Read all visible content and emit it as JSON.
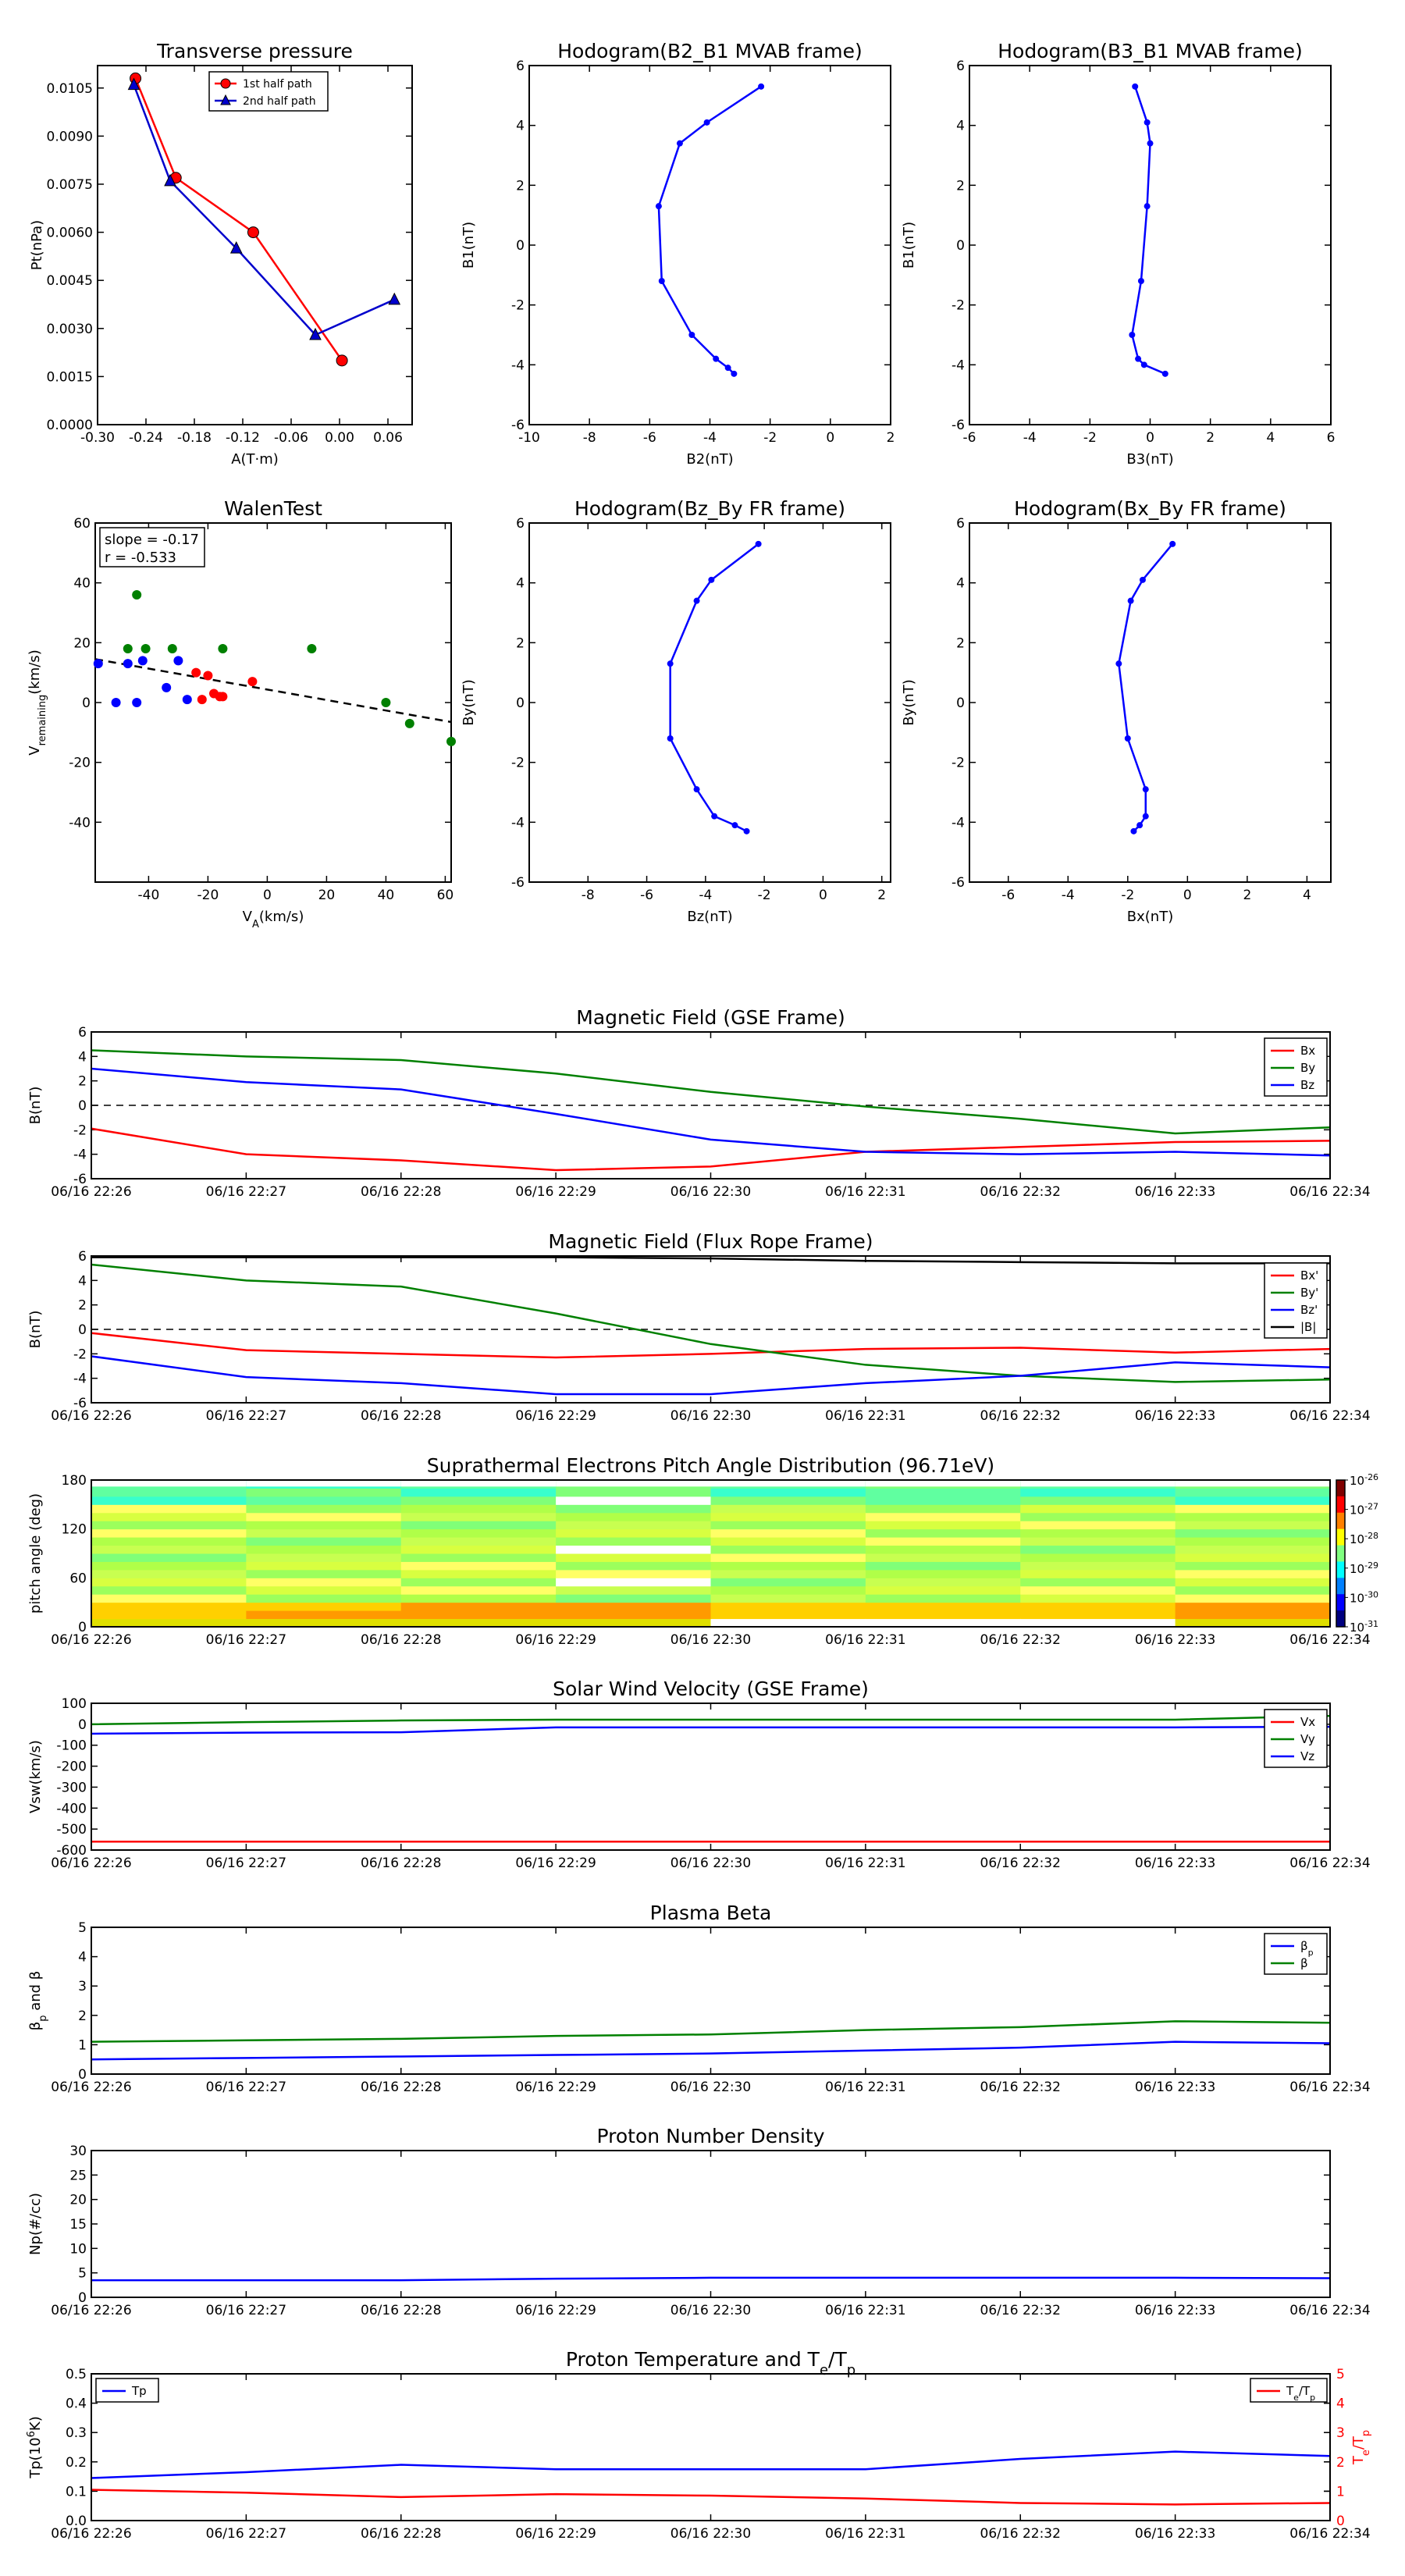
{
  "colors": {
    "red": "#ff0000",
    "green": "#008000",
    "blue": "#0000ff",
    "black": "#000000"
  },
  "chart_data": [
    {
      "id": "pt",
      "type": "scatter",
      "title": "Transverse pressure",
      "xlabel": "A(T·m)",
      "ylabel": "Pt(nPa)",
      "xlim": [
        -0.3,
        0.09
      ],
      "ylim": [
        0.0,
        0.0112
      ],
      "xticks": [
        "-0.30",
        "-0.24",
        "-0.18",
        "-0.12",
        "-0.06",
        "0.00",
        "0.06"
      ],
      "xtick_values": [
        -0.3,
        -0.24,
        -0.18,
        -0.12,
        -0.06,
        0.0,
        0.06
      ],
      "yticks": [
        "0.0000",
        "0.0015",
        "0.0030",
        "0.0045",
        "0.0060",
        "0.0075",
        "0.0090",
        "0.0105"
      ],
      "ytick_values": [
        0,
        0.0015,
        0.003,
        0.0045,
        0.006,
        0.0075,
        0.009,
        0.0105
      ],
      "legend": [
        {
          "label": "1st half path",
          "color": "#ff0000",
          "marker": "circle"
        },
        {
          "label": "2nd half path",
          "color": "#0000cc",
          "marker": "triangle"
        }
      ],
      "series": [
        {
          "name": "1st half path",
          "color": "#ff0000",
          "marker": "circle",
          "x": [
            -0.253,
            -0.203,
            -0.107,
            0.003
          ],
          "y": [
            0.0108,
            0.0077,
            0.006,
            0.002
          ]
        },
        {
          "name": "2nd half path",
          "color": "#0000cc",
          "marker": "triangle",
          "x": [
            -0.255,
            -0.21,
            -0.128,
            -0.03,
            0.068
          ],
          "y": [
            0.0106,
            0.0076,
            0.0055,
            0.0028,
            0.0039
          ]
        }
      ]
    },
    {
      "id": "h1",
      "type": "line",
      "title": "Hodogram(B2_B1 MVAB frame)",
      "xlabel": "B2(nT)",
      "ylabel": "B1(nT)",
      "xlim": [
        -10,
        2
      ],
      "ylim": [
        -6,
        6
      ],
      "xticks": [
        "-10",
        "-8",
        "-6",
        "-4",
        "-2",
        "0",
        "2"
      ],
      "xtick_values": [
        -10,
        -8,
        -6,
        -4,
        -2,
        0,
        2
      ],
      "yticks": [
        "-6",
        "-4",
        "-2",
        "0",
        "2",
        "4",
        "6"
      ],
      "ytick_values": [
        -6,
        -4,
        -2,
        0,
        2,
        4,
        6
      ],
      "series": [
        {
          "color": "#0000ff",
          "x": [
            -2.3,
            -4.1,
            -5.0,
            -5.7,
            -5.6,
            -4.6,
            -3.8,
            -3.4,
            -3.2
          ],
          "y": [
            5.3,
            4.1,
            3.4,
            1.3,
            -1.2,
            -3.0,
            -3.8,
            -4.1,
            -4.3
          ]
        }
      ]
    },
    {
      "id": "h2",
      "type": "line",
      "title": "Hodogram(B3_B1 MVAB frame)",
      "xlabel": "B3(nT)",
      "ylabel": "B1(nT)",
      "xlim": [
        -6,
        6
      ],
      "ylim": [
        -6,
        6
      ],
      "xticks": [
        "-6",
        "-4",
        "-2",
        "0",
        "2",
        "4",
        "6"
      ],
      "xtick_values": [
        -6,
        -4,
        -2,
        0,
        2,
        4,
        6
      ],
      "yticks": [
        "-6",
        "-4",
        "-2",
        "0",
        "2",
        "4",
        "6"
      ],
      "ytick_values": [
        -6,
        -4,
        -2,
        0,
        2,
        4,
        6
      ],
      "series": [
        {
          "color": "#0000ff",
          "x": [
            -0.5,
            -0.1,
            0.0,
            -0.1,
            -0.3,
            -0.6,
            -0.4,
            -0.2,
            0.5
          ],
          "y": [
            5.3,
            4.1,
            3.4,
            1.3,
            -1.2,
            -3.0,
            -3.8,
            -4.0,
            -4.3
          ]
        }
      ]
    },
    {
      "id": "walen",
      "type": "scatter",
      "title": "WalenTest",
      "xlabel": "V<sub>A</sub>(km/s)",
      "ylabel": "V<sub>remaining</sub>(km/s)",
      "xlim": [
        -58,
        62
      ],
      "ylim": [
        -60,
        60
      ],
      "xticks": [
        "-40",
        "-20",
        "0",
        "20",
        "40",
        "60"
      ],
      "xtick_values": [
        -40,
        -20,
        0,
        20,
        40,
        60
      ],
      "yticks": [
        "-40",
        "-20",
        "0",
        "20",
        "40",
        "60"
      ],
      "ytick_values": [
        -40,
        -20,
        0,
        20,
        40,
        60
      ],
      "annotation": [
        "slope = -0.17",
        "r = -0.533"
      ],
      "fit_line": {
        "x": [
          -58,
          62
        ],
        "y": [
          14.5,
          -6.5
        ]
      },
      "series": [
        {
          "color": "#0000ff",
          "x": [
            -57,
            -51,
            -47,
            -44,
            -42,
            -34,
            -30,
            -27
          ],
          "y": [
            13,
            0,
            13,
            0,
            14,
            5,
            14,
            1
          ]
        },
        {
          "color": "#ff0000",
          "x": [
            -24,
            -22,
            -20,
            -18,
            -16,
            -15,
            -5
          ],
          "y": [
            10,
            1,
            9,
            3,
            2,
            2,
            7
          ]
        },
        {
          "color": "#008000",
          "x": [
            -47,
            -44,
            -41,
            -32,
            -15,
            15,
            40,
            48,
            62
          ],
          "y": [
            18,
            36,
            18,
            18,
            18,
            18,
            0,
            -7,
            -13
          ]
        }
      ]
    },
    {
      "id": "h3",
      "type": "line",
      "title": "Hodogram(Bz_By FR frame)",
      "xlabel": "Bz(nT)",
      "ylabel": "By(nT)",
      "xlim": [
        -10,
        2.3
      ],
      "ylim": [
        -6,
        6
      ],
      "xticks": [
        "-8",
        "-6",
        "-4",
        "-2",
        "0",
        "2"
      ],
      "xtick_values": [
        -8,
        -6,
        -4,
        -2,
        0,
        2
      ],
      "yticks": [
        "-6",
        "-4",
        "-2",
        "0",
        "2",
        "4",
        "6"
      ],
      "ytick_values": [
        -6,
        -4,
        -2,
        0,
        2,
        4,
        6
      ],
      "series": [
        {
          "color": "#0000ff",
          "x": [
            -2.2,
            -3.8,
            -4.3,
            -5.2,
            -5.2,
            -4.3,
            -3.7,
            -3.0,
            -2.6
          ],
          "y": [
            5.3,
            4.1,
            3.4,
            1.3,
            -1.2,
            -2.9,
            -3.8,
            -4.1,
            -4.3
          ]
        }
      ]
    },
    {
      "id": "h4",
      "type": "line",
      "title": "Hodogram(Bx_By FR frame)",
      "xlabel": "Bx(nT)",
      "ylabel": "By(nT)",
      "xlim": [
        -7.3,
        4.8
      ],
      "ylim": [
        -6,
        6
      ],
      "xticks": [
        "-6",
        "-4",
        "-2",
        "0",
        "2",
        "4"
      ],
      "xtick_values": [
        -6,
        -4,
        -2,
        0,
        2,
        4
      ],
      "yticks": [
        "-6",
        "-4",
        "-2",
        "0",
        "2",
        "4",
        "6"
      ],
      "ytick_values": [
        -6,
        -4,
        -2,
        0,
        2,
        4,
        6
      ],
      "series": [
        {
          "color": "#0000ff",
          "x": [
            -0.5,
            -1.5,
            -1.9,
            -2.3,
            -2.0,
            -1.4,
            -1.4,
            -1.6,
            -1.8
          ],
          "y": [
            5.3,
            4.1,
            3.4,
            1.3,
            -1.2,
            -2.9,
            -3.8,
            -4.1,
            -4.3
          ]
        }
      ]
    },
    {
      "id": "mag_gse",
      "type": "line",
      "title": "Magnetic Field (GSE Frame)",
      "ylabel": "B(nT)",
      "ylim": [
        -6,
        6
      ],
      "yticks": [
        "-6",
        "-4",
        "-2",
        "0",
        "2",
        "4",
        "6"
      ],
      "ytick_values": [
        -6,
        -4,
        -2,
        0,
        2,
        4,
        6
      ],
      "zero_line": true,
      "legend": [
        "Bx",
        "By",
        "Bz"
      ],
      "series": [
        {
          "name": "Bx",
          "color": "#ff0000",
          "values": [
            -1.9,
            -4.0,
            -4.5,
            -5.3,
            -5.0,
            -3.8,
            -3.4,
            -3.0,
            -2.9
          ]
        },
        {
          "name": "By",
          "color": "#008000",
          "values": [
            4.5,
            4.0,
            3.7,
            2.6,
            1.1,
            -0.1,
            -1.1,
            -2.3,
            -1.8
          ]
        },
        {
          "name": "Bz",
          "color": "#0000ff",
          "values": [
            3.0,
            1.9,
            1.3,
            -0.7,
            -2.8,
            -3.8,
            -4.0,
            -3.8,
            -4.1
          ]
        }
      ]
    },
    {
      "id": "mag_fr",
      "type": "line",
      "title": "Magnetic Field (Flux Rope Frame)",
      "ylabel": "B(nT)",
      "ylim": [
        -6,
        6
      ],
      "yticks": [
        "-6",
        "-4",
        "-2",
        "0",
        "2",
        "4",
        "6"
      ],
      "ytick_values": [
        -6,
        -4,
        -2,
        0,
        2,
        4,
        6
      ],
      "zero_line": true,
      "legend": [
        "Bx'",
        "By'",
        "Bz'",
        "|B|"
      ],
      "series": [
        {
          "name": "Bx'",
          "color": "#ff0000",
          "values": [
            -0.3,
            -1.7,
            -2.0,
            -2.3,
            -2.0,
            -1.6,
            -1.5,
            -1.9,
            -1.6
          ]
        },
        {
          "name": "By'",
          "color": "#008000",
          "values": [
            5.3,
            4.0,
            3.5,
            1.3,
            -1.2,
            -2.9,
            -3.8,
            -4.3,
            -4.1
          ]
        },
        {
          "name": "Bz'",
          "color": "#0000ff",
          "values": [
            -2.2,
            -3.9,
            -4.4,
            -5.3,
            -5.3,
            -4.4,
            -3.8,
            -2.7,
            -3.1
          ]
        },
        {
          "name": "|B|",
          "color": "#000000",
          "values": [
            5.9,
            5.9,
            5.9,
            5.9,
            5.8,
            5.6,
            5.5,
            5.4,
            5.4
          ]
        }
      ]
    },
    {
      "id": "pad",
      "type": "heatmap",
      "title": "Suprathermal Electrons Pitch Angle Distribution (96.71eV)",
      "ylabel": "pitch angle (deg)",
      "ylim": [
        0,
        180
      ],
      "yticks": [
        "0",
        "60",
        "120",
        "180"
      ],
      "ytick_values": [
        0,
        60,
        120,
        180
      ],
      "colorbar_ticks": [
        "10<sup>-26</sup>",
        "10<sup>-27</sup>",
        "10<sup>-28</sup>",
        "10<sup>-29</sup>",
        "10<sup>-30</sup>",
        "10<sup>-31</sup>"
      ],
      "colorbar_exponents": [
        -26,
        -27,
        -28,
        -29,
        -30,
        -31
      ]
    },
    {
      "id": "vsw",
      "type": "line",
      "title": "Solar Wind Velocity (GSE Frame)",
      "ylabel": "Vsw(km/s)",
      "ylim": [
        -600,
        100
      ],
      "yticks": [
        "-600",
        "-500",
        "-400",
        "-300",
        "-200",
        "-100",
        "0",
        "100"
      ],
      "ytick_values": [
        -600,
        -500,
        -400,
        -300,
        -200,
        -100,
        0,
        100
      ],
      "legend": [
        "Vx",
        "Vy",
        "Vz"
      ],
      "series": [
        {
          "name": "Vx",
          "color": "#ff0000",
          "values": [
            -560,
            -560,
            -560,
            -560,
            -560,
            -560,
            -560,
            -560,
            -560
          ]
        },
        {
          "name": "Vy",
          "color": "#008000",
          "values": [
            0,
            10,
            18,
            22,
            22,
            22,
            22,
            22,
            40
          ]
        },
        {
          "name": "Vz",
          "color": "#0000ff",
          "values": [
            -45,
            -40,
            -38,
            -15,
            -15,
            -15,
            -15,
            -15,
            -12
          ]
        }
      ]
    },
    {
      "id": "beta",
      "type": "line",
      "title": "Plasma Beta",
      "ylabel": "β<sub>p</sub> and β",
      "ylim": [
        0,
        5
      ],
      "yticks": [
        "0",
        "1",
        "2",
        "3",
        "4",
        "5"
      ],
      "ytick_values": [
        0,
        1,
        2,
        3,
        4,
        5
      ],
      "legend": [
        "β<sub>p</sub>",
        "β"
      ],
      "series": [
        {
          "name": "β<sub>p</sub>",
          "color": "#0000ff",
          "values": [
            0.5,
            0.55,
            0.6,
            0.65,
            0.7,
            0.8,
            0.9,
            1.1,
            1.05
          ]
        },
        {
          "name": "β",
          "color": "#008000",
          "values": [
            1.1,
            1.15,
            1.2,
            1.3,
            1.35,
            1.5,
            1.6,
            1.8,
            1.75
          ]
        }
      ]
    },
    {
      "id": "np",
      "type": "line",
      "title": "Proton Number Density",
      "ylabel": "Np(#/cc)",
      "ylim": [
        0,
        30
      ],
      "yticks": [
        "0",
        "5",
        "10",
        "15",
        "20",
        "25",
        "30"
      ],
      "ytick_values": [
        0,
        5,
        10,
        15,
        20,
        25,
        30
      ],
      "series": [
        {
          "color": "#0000ff",
          "values": [
            3.5,
            3.5,
            3.5,
            3.8,
            4.0,
            4.0,
            4.0,
            4.0,
            3.9
          ]
        }
      ]
    },
    {
      "id": "tp",
      "type": "line",
      "title": "Proton Temperature and T<sub>e</sub>/T<sub>p</sub>",
      "ylabel": "Tp(10<sup>6</sup>K)",
      "ylabel_right": "T<sub>e</sub>/T<sub>p</sub>",
      "ylim": [
        0,
        0.5
      ],
      "ylim_right": [
        0,
        5
      ],
      "yticks": [
        "0.0",
        "0.1",
        "0.2",
        "0.3",
        "0.4",
        "0.5"
      ],
      "ytick_values": [
        0,
        0.1,
        0.2,
        0.3,
        0.4,
        0.5
      ],
      "yticks_right": [
        "0",
        "1",
        "2",
        "3",
        "4",
        "5"
      ],
      "ytick_values_right": [
        0,
        1,
        2,
        3,
        4,
        5
      ],
      "legend_left": "Tp",
      "legend_right": "T<sub>e</sub>/T<sub>p</sub>",
      "series": [
        {
          "name": "Tp",
          "color": "#0000ff",
          "axis": "left",
          "values": [
            0.145,
            0.165,
            0.19,
            0.175,
            0.175,
            0.175,
            0.21,
            0.235,
            0.22
          ]
        },
        {
          "name": "T<sub>e</sub>/T<sub>p</sub>",
          "color": "#ff0000",
          "axis": "right",
          "values": [
            1.05,
            0.95,
            0.8,
            0.9,
            0.85,
            0.75,
            0.6,
            0.55,
            0.6
          ]
        }
      ]
    }
  ],
  "time_axis_labels": [
    "06/16 22:26",
    "06/16 22:27",
    "06/16 22:28",
    "06/16 22:29",
    "06/16 22:30",
    "06/16 22:31",
    "06/16 22:32",
    "06/16 22:33",
    "06/16 22:34"
  ]
}
